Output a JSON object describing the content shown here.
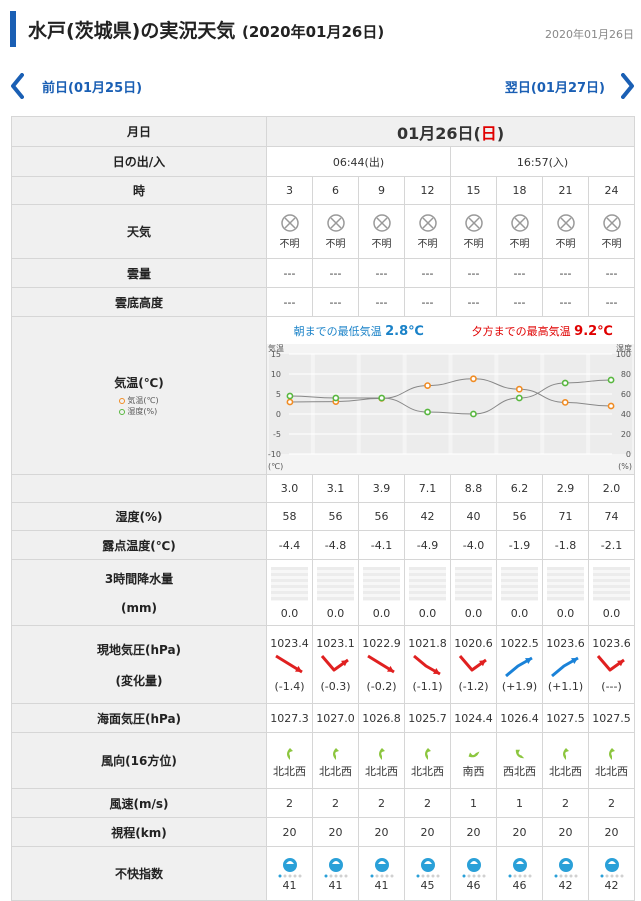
{
  "header": {
    "title": "水戸(茨城県)の実況天気",
    "title_date": "(2020年01月26日)",
    "date": "2020年01月26日"
  },
  "nav": {
    "prev_label": "前日(01月25日)",
    "next_label": "翌日(01月27日)"
  },
  "labels": {
    "date": "月日",
    "sunrise": "日の出/入",
    "hour": "時",
    "weather": "天気",
    "cloud": "雲量",
    "cloud_base": "雲底高度",
    "temp": "気温(℃)",
    "legend_temp": "気温(℃)",
    "legend_hum": "湿度(%)",
    "humidity": "湿度(%)",
    "dewpoint": "露点温度(℃)",
    "precip_line1": "3時間降水量",
    "precip_line2": "(mm)",
    "pressure_line1": "現地気圧(hPa)",
    "pressure_line2": "(変化量)",
    "sea_pressure": "海面気圧(hPa)",
    "wind_dir": "風向(16方位)",
    "wind_speed": "風速(m/s)",
    "visibility": "視程(km)",
    "discomfort": "不快指数"
  },
  "day": {
    "text": "01月26日(",
    "dow": "日",
    "close": ")"
  },
  "sun": {
    "rise": "06:44(出)",
    "set": "16:57(入)"
  },
  "hours": [
    "3",
    "6",
    "9",
    "12",
    "15",
    "18",
    "21",
    "24"
  ],
  "weather": [
    "不明",
    "不明",
    "不明",
    "不明",
    "不明",
    "不明",
    "不明",
    "不明"
  ],
  "cloud": [
    "---",
    "---",
    "---",
    "---",
    "---",
    "---",
    "---",
    "---"
  ],
  "cloud_base": [
    "---",
    "---",
    "---",
    "---",
    "---",
    "---",
    "---",
    "---"
  ],
  "minmax": {
    "min_label": "朝までの最低気温",
    "min_value": "2.8℃",
    "max_label": "夕方までの最高気温",
    "max_value": "9.2℃"
  },
  "chart_data": {
    "type": "line",
    "x": [
      "3",
      "6",
      "9",
      "12",
      "15",
      "18",
      "21",
      "24"
    ],
    "series": [
      {
        "name": "気温(℃)",
        "values": [
          3.0,
          3.1,
          3.9,
          7.1,
          8.8,
          6.2,
          2.9,
          2.0
        ],
        "axis": "left",
        "color": "#f08c24"
      },
      {
        "name": "湿度(%)",
        "values": [
          58,
          56,
          56,
          42,
          40,
          56,
          71,
          74
        ],
        "axis": "right",
        "color": "#58b73f"
      }
    ],
    "y_left": {
      "label": "気温",
      "unit": "(℃)",
      "range": [
        -10,
        15
      ],
      "ticks": [
        "15",
        "10",
        "5",
        "0",
        "-5",
        "-10"
      ]
    },
    "y_right": {
      "label": "湿度",
      "unit": "(%)",
      "range": [
        0,
        100
      ],
      "ticks": [
        "100",
        "80",
        "60",
        "40",
        "20",
        "0"
      ]
    },
    "grid": true
  },
  "temp": [
    "3.0",
    "3.1",
    "3.9",
    "7.1",
    "8.8",
    "6.2",
    "2.9",
    "2.0"
  ],
  "humidity": [
    "58",
    "56",
    "56",
    "42",
    "40",
    "56",
    "71",
    "74"
  ],
  "dewpoint": [
    "-4.4",
    "-4.8",
    "-4.1",
    "-4.9",
    "-4.0",
    "-1.9",
    "-1.8",
    "-2.1"
  ],
  "precip": [
    "0.0",
    "0.0",
    "0.0",
    "0.0",
    "0.0",
    "0.0",
    "0.0",
    "0.0"
  ],
  "pressure": [
    "1023.4",
    "1023.1",
    "1022.9",
    "1021.8",
    "1020.6",
    "1022.5",
    "1023.6",
    "1023.6"
  ],
  "pressure_change": [
    "(-1.4)",
    "(-0.3)",
    "(-0.2)",
    "(-1.1)",
    "(-1.2)",
    "(+1.9)",
    "(+1.1)",
    "(---)"
  ],
  "pressure_trend": [
    "down",
    "down-up",
    "down",
    "down-down",
    "down-up",
    "up",
    "up",
    "down-up"
  ],
  "sea_pressure": [
    "1027.3",
    "1027.0",
    "1026.8",
    "1025.7",
    "1024.4",
    "1026.4",
    "1027.5",
    "1027.5"
  ],
  "wind_dir": [
    "北北西",
    "北北西",
    "北北西",
    "北北西",
    "南西",
    "西北西",
    "北北西",
    "北北西"
  ],
  "wind_speed": [
    "2",
    "2",
    "2",
    "2",
    "1",
    "1",
    "2",
    "2"
  ],
  "visibility": [
    "20",
    "20",
    "20",
    "20",
    "20",
    "20",
    "20",
    "20"
  ],
  "discomfort": [
    "41",
    "41",
    "41",
    "45",
    "46",
    "46",
    "42",
    "42"
  ],
  "colors": {
    "accent": "#1a5fb4",
    "sunday": "#e00000",
    "down": "#e02020",
    "up": "#1a82d8",
    "wind": "#8cc63f",
    "disc": "#2aa0d8"
  }
}
